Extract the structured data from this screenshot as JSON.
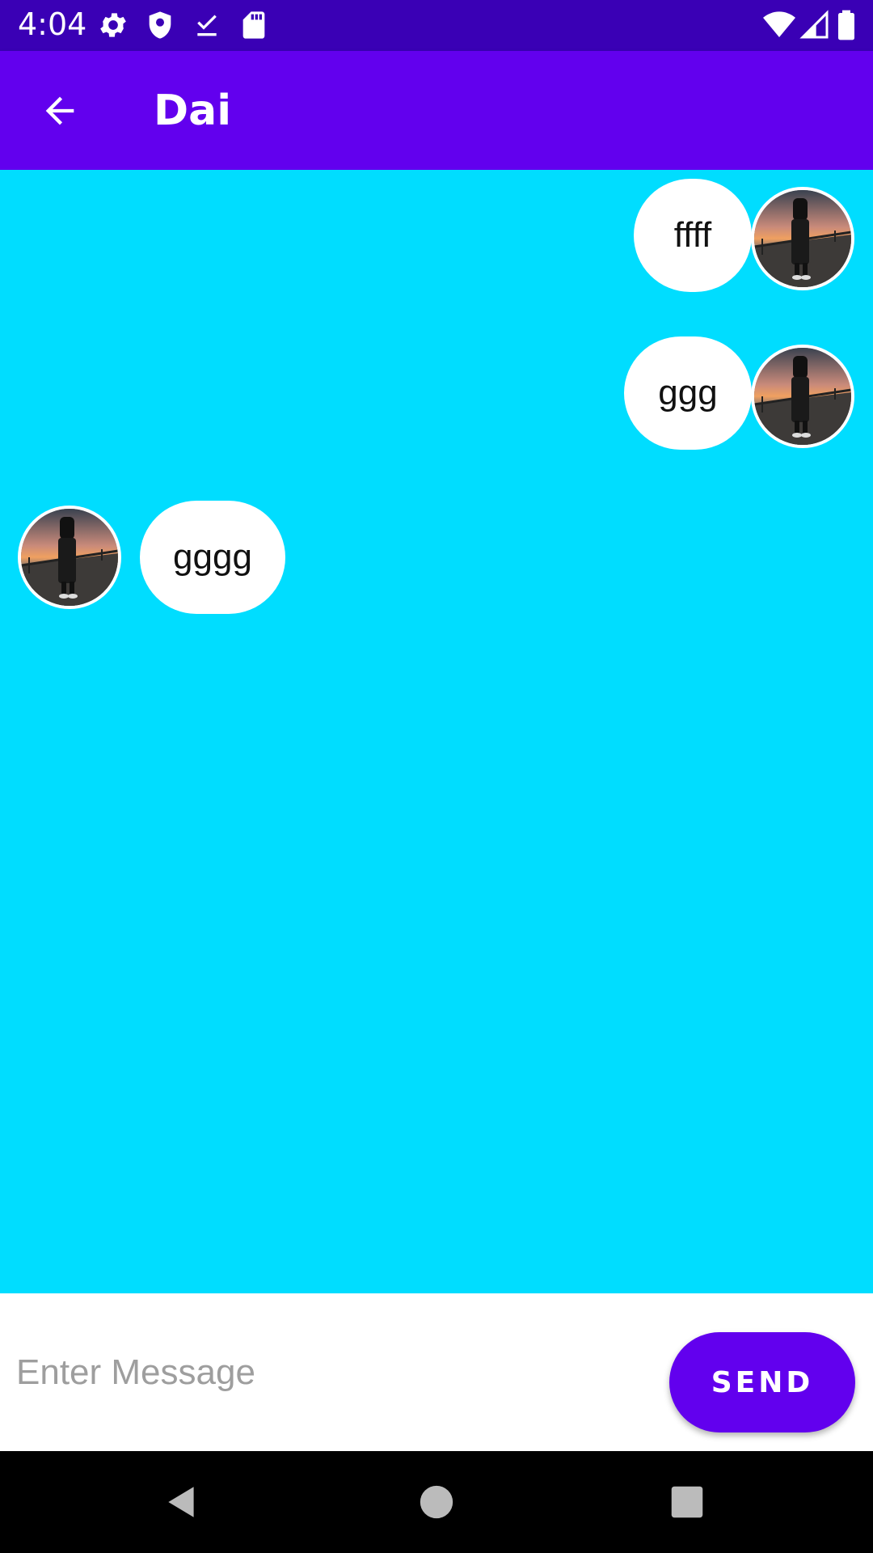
{
  "status_bar": {
    "time": "4:04",
    "left_icons": [
      "gear-icon",
      "shield-icon",
      "download-done-icon",
      "sd-card-icon"
    ],
    "right_icons": [
      "wifi-icon",
      "signal-icon",
      "battery-icon"
    ]
  },
  "app_bar": {
    "back_icon": "arrow-back-icon",
    "title": "Dai",
    "color": "#6200EE"
  },
  "chat": {
    "background": "#00DDFF",
    "messages": [
      {
        "text": "ffff",
        "side": "right"
      },
      {
        "text": "ggg",
        "side": "right"
      },
      {
        "text": "gggg",
        "side": "left"
      }
    ]
  },
  "input": {
    "placeholder": "Enter Message",
    "value": "",
    "send_label": "SEND"
  },
  "nav_bar": {
    "icons": [
      "back-triangle-icon",
      "home-circle-icon",
      "recents-square-icon"
    ]
  }
}
